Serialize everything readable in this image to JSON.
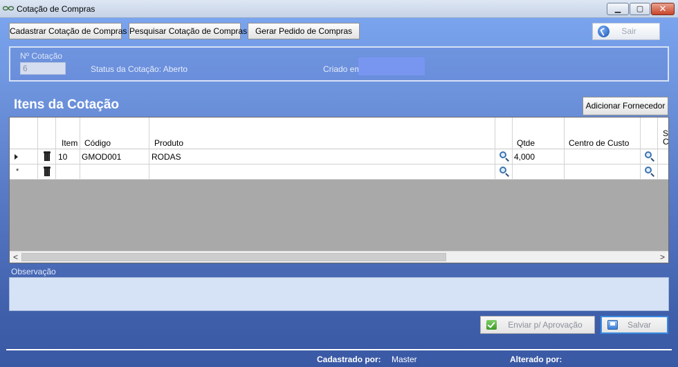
{
  "window": {
    "title": "Cotação de Compras",
    "minimize_glyph": "▁",
    "maximize_glyph": "▢",
    "close_glyph": "✕"
  },
  "toolbar": {
    "cadastrar_label": "Cadastrar Cotação de Compras",
    "pesquisar_label": "Pesquisar Cotação de Compras",
    "gerar_label": "Gerar Pedido de Compras",
    "sair_label": "Sair"
  },
  "header": {
    "num_cotacao_label": "Nº Cotação",
    "num_cotacao_value": "6",
    "status_label": "Status da Cotação: Aberto",
    "criado_em_label": "Criado em:",
    "criado_em_value": ""
  },
  "itens": {
    "title": "Itens da Cotação",
    "add_fornecedor_label": "Adicionar Fornecedor",
    "columns": {
      "item": "Item",
      "codigo": "Código",
      "produto": "Produto",
      "qtde": "Qtde",
      "centro_custo": "Centro de Custo",
      "cut_top": "S",
      "cut_bottom": "C"
    },
    "rows": [
      {
        "item": "10",
        "codigo": "GMOD001",
        "produto": "RODAS",
        "qtde": "4,000",
        "centro_custo": ""
      }
    ],
    "new_row_marker": "*",
    "scroll_left": "<",
    "scroll_right": ">"
  },
  "observacao": {
    "label": "Observação",
    "value": ""
  },
  "actions": {
    "enviar_label": "Enviar p/ Aprovação",
    "salvar_label": "Salvar"
  },
  "footer": {
    "cadastrado_por_label": "Cadastrado por:",
    "cadastrado_por_value": "Master",
    "alterado_por_label": "Alterado por:",
    "alterado_por_value": ""
  }
}
